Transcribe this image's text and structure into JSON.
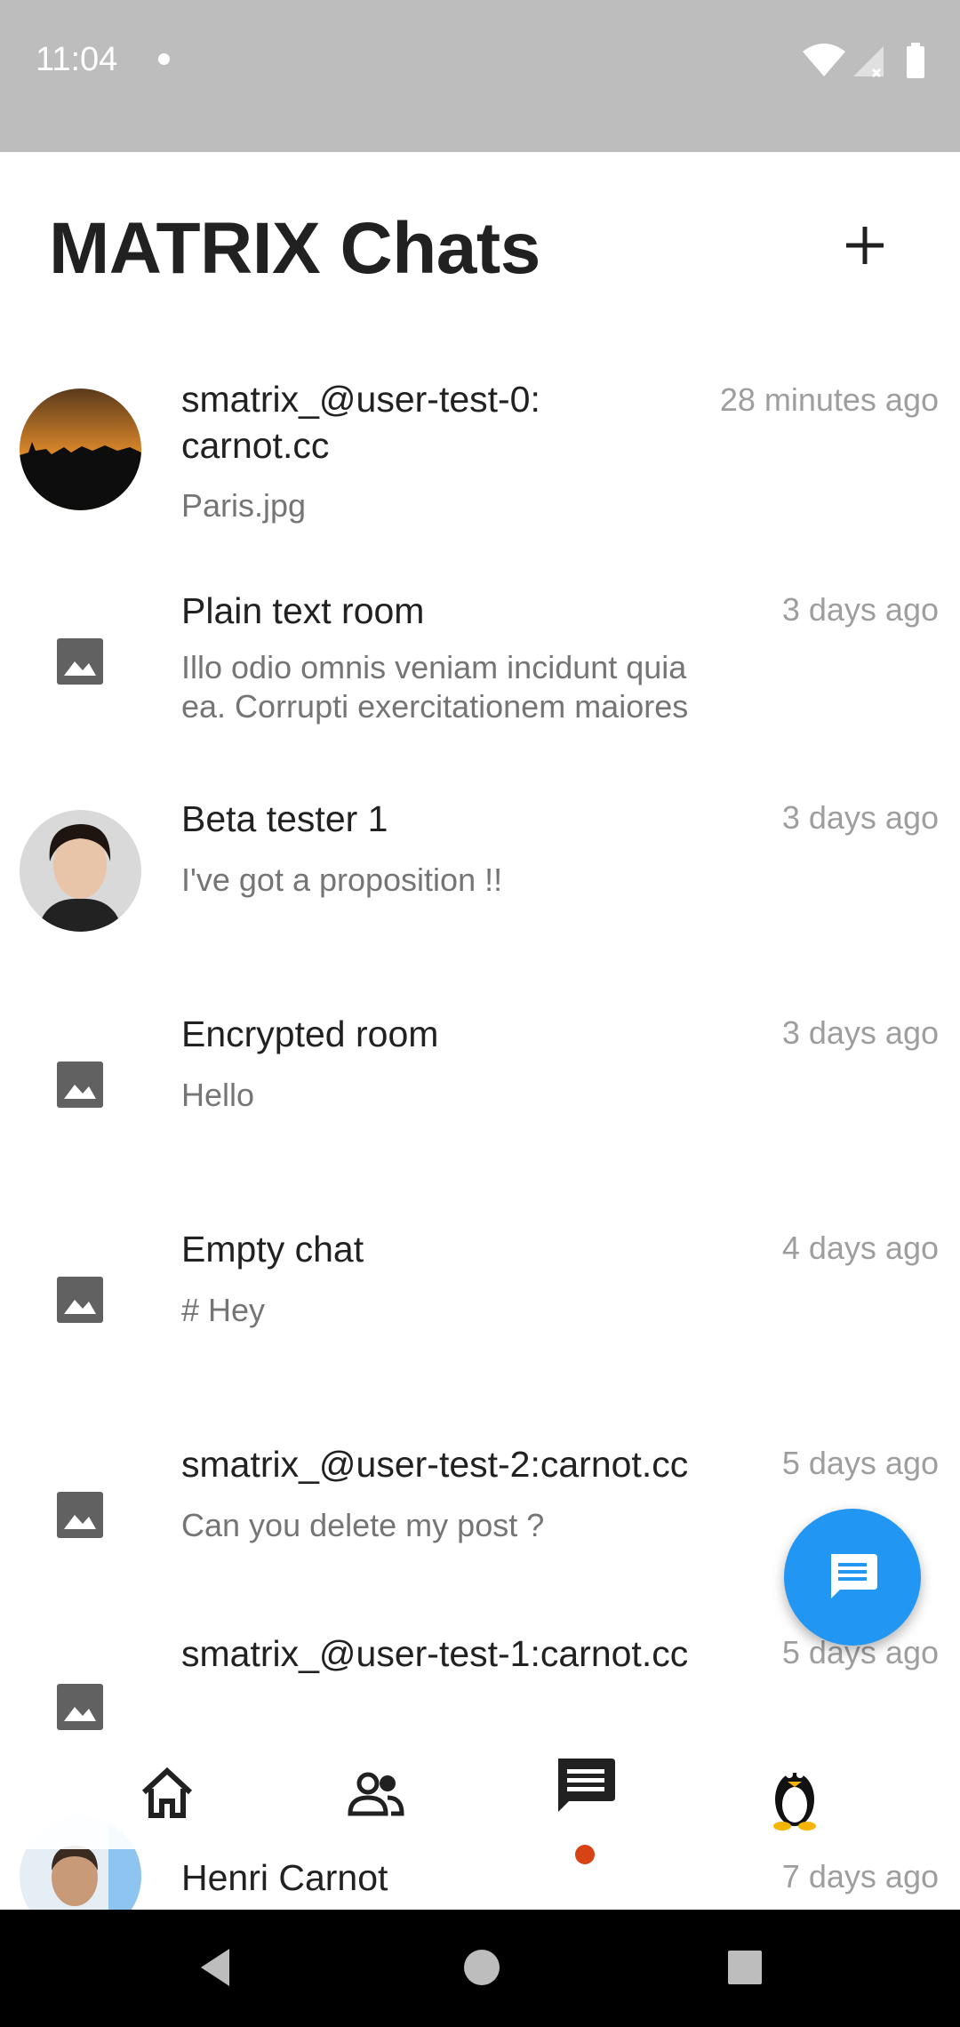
{
  "status_bar": {
    "time": "11:04",
    "icons": [
      "notification-dot-icon",
      "wifi-icon",
      "signal-icon",
      "battery-icon"
    ]
  },
  "header": {
    "title": "MATRIX Chats",
    "add_icon": "plus-icon"
  },
  "chats": [
    {
      "name": "smatrix_@user-test-0:\ncarnot.cc",
      "preview": "Paris.jpg",
      "time": "28 minutes ago",
      "avatar": "photo-sunset"
    },
    {
      "name": "Plain text room",
      "preview": "Illo odio omnis veniam incidunt quia ea. Corrupti exercitationem maiores",
      "time": "3 days ago",
      "avatar": "image-placeholder-icon"
    },
    {
      "name": "Beta tester 1",
      "preview": "I've got a proposition !!",
      "time": "3 days ago",
      "avatar": "photo-person"
    },
    {
      "name": "Encrypted room",
      "preview": "Hello",
      "time": "3 days ago",
      "avatar": "image-placeholder-icon"
    },
    {
      "name": "Empty chat",
      "preview": "# Hey",
      "time": "4 days ago",
      "avatar": "image-placeholder-icon"
    },
    {
      "name": "smatrix_@user-test-2:carnot.cc",
      "preview": "Can you delete my post ?",
      "time": "5 days ago",
      "avatar": "image-placeholder-icon"
    },
    {
      "name": "smatrix_@user-test-1:carnot.cc",
      "preview": "",
      "time": "5 days ago",
      "avatar": "image-placeholder-icon"
    },
    {
      "name": "Henri Carnot",
      "preview": "",
      "time": "7 days ago",
      "avatar": "photo-person-2"
    }
  ],
  "fab": {
    "icon": "chat-message-icon"
  },
  "bottom_nav": {
    "items": [
      "home-icon",
      "people-icon",
      "chat-icon",
      "profile-penguin-icon"
    ],
    "active_index": 2,
    "indicator_color": "#d84315"
  },
  "system_nav": [
    "back-icon",
    "home-circle-icon",
    "recents-square-icon"
  ],
  "colors": {
    "accent": "#2196f3",
    "status_bar": "#bdbdbd"
  }
}
